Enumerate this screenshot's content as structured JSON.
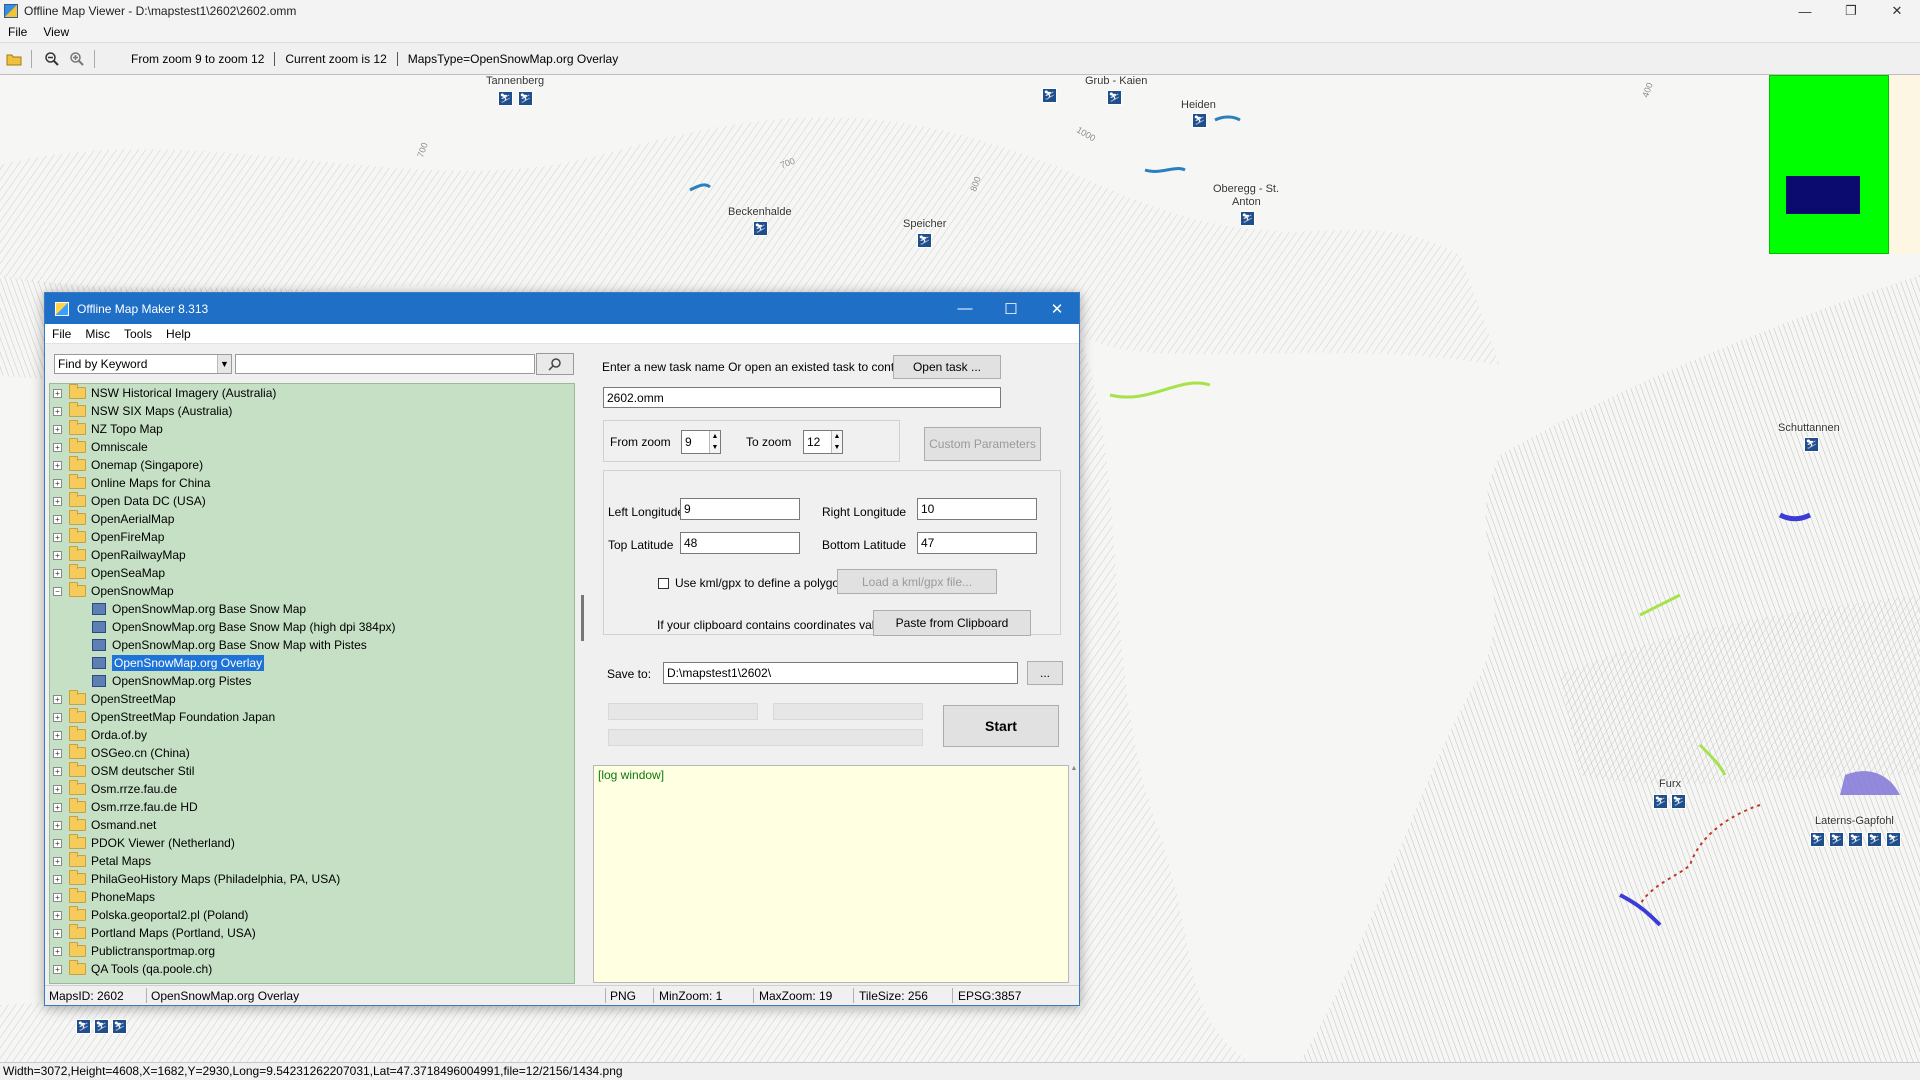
{
  "viewer": {
    "title": "Offline Map Viewer - D:\\mapstest1\\2602\\2602.omm",
    "menu": [
      "File",
      "View"
    ],
    "toolbar": {
      "from_zoom_text": "From zoom 9 to zoom 12",
      "current_zoom_text": "Current zoom is 12",
      "maps_type_text": "MapsType=OpenSnowMap.org Overlay"
    },
    "status": "Width=3072,Height=4608,X=1682,Y=2930,Long=9.54231262207031,Lat=47.3718496004991,file=12/2156/1434.png"
  },
  "map_labels": {
    "tannenberg": "Tannenberg",
    "grub_kaien": "Grub - Kaien",
    "heiden": "Heiden",
    "beckenhalde": "Beckenhalde",
    "speicher": "Speicher",
    "oberegg": "Oberegg - St.",
    "anton": "Anton",
    "schuttannen": "Schuttannen",
    "furx": "Furx",
    "laterns": "Laterns-Gapfohl",
    "contour_700a": "700",
    "contour_700b": "700",
    "contour_800": "800",
    "contour_1000": "1000",
    "contour_400": "400"
  },
  "dialog": {
    "title": "Offline Map Maker 8.313",
    "menu": [
      "File",
      "Misc",
      "Tools",
      "Help"
    ],
    "search_mode": "Find by Keyword",
    "search_value": "",
    "tree": {
      "items_before": [
        "NSW Historical Imagery (Australia)",
        "NSW SIX Maps (Australia)",
        "NZ Topo Map",
        "Omniscale",
        "Onemap (Singapore)",
        "Online Maps for China",
        "Open Data DC (USA)",
        "OpenAerialMap",
        "OpenFireMap",
        "OpenRailwayMap",
        "OpenSeaMap"
      ],
      "expanded": "OpenSnowMap",
      "children": [
        "OpenSnowMap.org Base Snow Map",
        "OpenSnowMap.org Base Snow Map (high dpi 384px)",
        "OpenSnowMap.org Base Snow Map with Pistes",
        "OpenSnowMap.org Overlay",
        "OpenSnowMap.org Pistes"
      ],
      "selected_child": "OpenSnowMap.org Overlay",
      "items_after": [
        "OpenStreetMap",
        "OpenStreetMap Foundation Japan",
        "Orda.of.by",
        "OSGeo.cn (China)",
        "OSM deutscher Stil",
        "Osm.rrze.fau.de",
        "Osm.rrze.fau.de HD",
        "Osmand.net",
        "PDOK Viewer (Netherland)",
        "Petal Maps",
        "PhilaGeoHistory Maps (Philadelphia, PA, USA)",
        "PhoneMaps",
        "Polska.geoportal2.pl (Poland)",
        "Portland Maps (Portland, USA)",
        "Publictransportmap.org",
        "QA Tools (qa.poole.ch)"
      ]
    },
    "task": {
      "prompt": "Enter a new task name Or open an existed task to continue:",
      "open_button": "Open task ...",
      "name": "2602.omm"
    },
    "zoom": {
      "from_label": "From zoom",
      "from_value": "9",
      "to_label": "To zoom",
      "to_value": "12",
      "custom_button": "Custom Parameters"
    },
    "coords": {
      "left_lon_label": "Left Longitude",
      "left_lon": "9",
      "right_lon_label": "Right Longitude",
      "right_lon": "10",
      "top_lat_label": "Top Latitude",
      "top_lat": "48",
      "bottom_lat_label": "Bottom Latitude",
      "bottom_lat": "47",
      "kml_label": "Use kml/gpx to define a polygon area",
      "kml_button": "Load a kml/gpx file...",
      "clip_label": "If your clipboard contains coordinates values:",
      "clip_button": "Paste from Clipboard"
    },
    "save": {
      "label": "Save to:",
      "path": "D:\\mapstest1\\2602\\",
      "browse": "...",
      "start": "Start"
    },
    "log": "[log window]",
    "status": {
      "maps_id": "MapsID: 2602",
      "name": "OpenSnowMap.org Overlay",
      "format": "PNG",
      "min_zoom": "MinZoom: 1",
      "max_zoom": "MaxZoom: 19",
      "tile_size": "TileSize: 256",
      "epsg": "EPSG:3857"
    }
  }
}
